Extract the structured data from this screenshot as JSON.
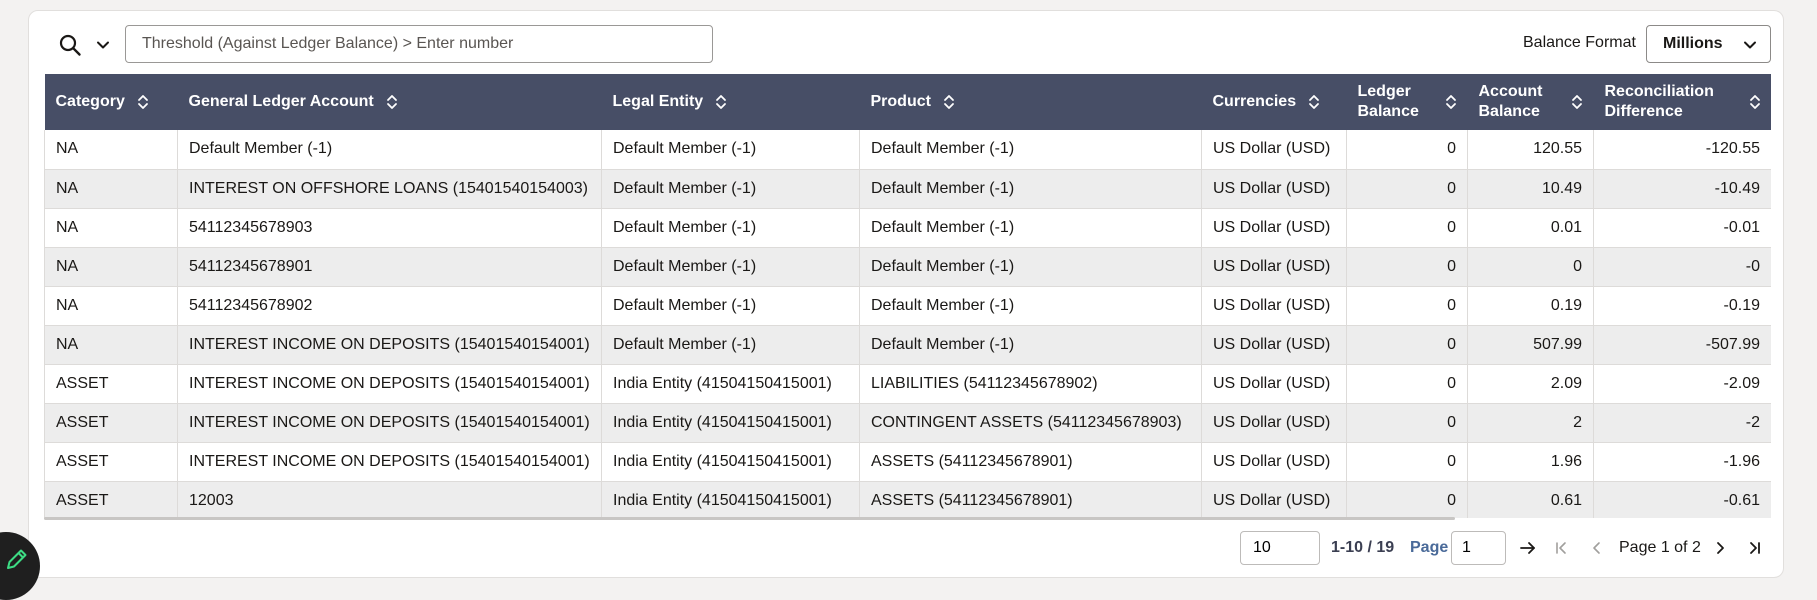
{
  "toolbar": {
    "threshold_placeholder": "Threshold (Against Ledger Balance) > Enter number",
    "balance_format_label": "Balance Format",
    "balance_format_value": "Millions"
  },
  "table": {
    "columns": [
      {
        "label": "Category"
      },
      {
        "label": "General Ledger Account"
      },
      {
        "label": "Legal Entity"
      },
      {
        "label": "Product"
      },
      {
        "label": "Currencies"
      },
      {
        "label": "Ledger Balance"
      },
      {
        "label": "Account Balance"
      },
      {
        "label": "Reconciliation Difference"
      }
    ],
    "rows": [
      [
        "NA",
        "Default Member (-1)",
        "Default Member (-1)",
        "Default Member (-1)",
        "US Dollar (USD)",
        "0",
        "120.55",
        "-120.55"
      ],
      [
        "NA",
        "INTEREST ON OFFSHORE LOANS (15401540154003)",
        "Default Member (-1)",
        "Default Member (-1)",
        "US Dollar (USD)",
        "0",
        "10.49",
        "-10.49"
      ],
      [
        "NA",
        "54112345678903",
        "Default Member (-1)",
        "Default Member (-1)",
        "US Dollar (USD)",
        "0",
        "0.01",
        "-0.01"
      ],
      [
        "NA",
        "54112345678901",
        "Default Member (-1)",
        "Default Member (-1)",
        "US Dollar (USD)",
        "0",
        "0",
        "-0"
      ],
      [
        "NA",
        "54112345678902",
        "Default Member (-1)",
        "Default Member (-1)",
        "US Dollar (USD)",
        "0",
        "0.19",
        "-0.19"
      ],
      [
        "NA",
        "INTEREST INCOME ON DEPOSITS (15401540154001)",
        "Default Member (-1)",
        "Default Member (-1)",
        "US Dollar (USD)",
        "0",
        "507.99",
        "-507.99"
      ],
      [
        "ASSET",
        "INTEREST INCOME ON DEPOSITS (15401540154001)",
        "India Entity (41504150415001)",
        "LIABILITIES (54112345678902)",
        "US Dollar (USD)",
        "0",
        "2.09",
        "-2.09"
      ],
      [
        "ASSET",
        "INTEREST INCOME ON DEPOSITS (15401540154001)",
        "India Entity (41504150415001)",
        "CONTINGENT ASSETS (54112345678903)",
        "US Dollar (USD)",
        "0",
        "2",
        "-2"
      ],
      [
        "ASSET",
        "INTEREST INCOME ON DEPOSITS (15401540154001)",
        "India Entity (41504150415001)",
        "ASSETS (54112345678901)",
        "US Dollar (USD)",
        "0",
        "1.96",
        "-1.96"
      ],
      [
        "ASSET",
        "12003",
        "India Entity (41504150415001)",
        "ASSETS (54112345678901)",
        "US Dollar (USD)",
        "0",
        "0.61",
        "-0.61"
      ]
    ]
  },
  "pagination": {
    "page_size": "10",
    "range_text": "1-10 / 19",
    "page_label": "Page",
    "page_input": "1",
    "page_of": "Page 1 of 2"
  },
  "icons": {
    "search": "search-icon",
    "filter_dropdown": "chevron-down-icon",
    "sort": "sort-icon",
    "go": "arrow-right-icon",
    "first": "first-page-icon",
    "prev": "previous-page-icon",
    "next": "next-page-icon",
    "last": "last-page-icon",
    "edit": "pencil-icon"
  },
  "colors": {
    "header_bg": "#474e66",
    "header_text": "#ffffff",
    "row_alt": "#ededed",
    "page_label": "#4a6a99",
    "fab_bg": "#1f1f1f",
    "fab_icon": "#3ddc84"
  }
}
